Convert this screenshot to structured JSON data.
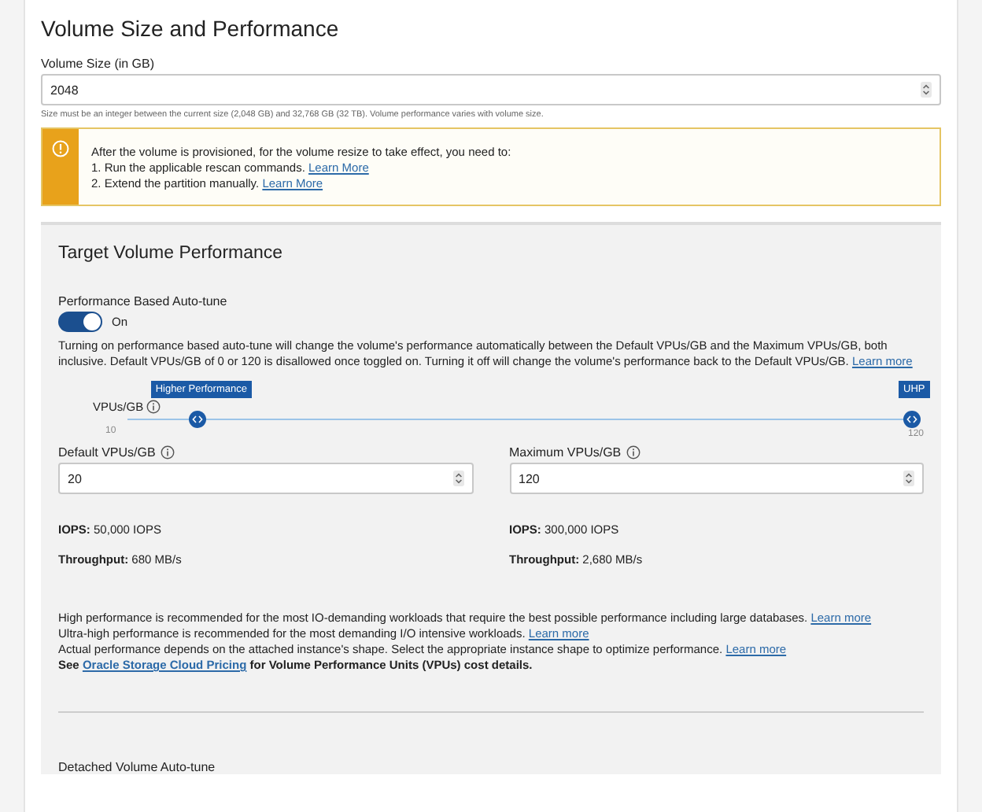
{
  "title": "Volume Size and Performance",
  "volume_size": {
    "label": "Volume Size (in GB)",
    "value": "2048",
    "help": "Size must be an integer between the current size (2,048 GB) and 32,768 GB (32 TB). Volume performance varies with volume size."
  },
  "notice": {
    "heading": "After the volume is provisioned, for the volume resize to take effect, you need to:",
    "items": [
      {
        "text": "1. Run the applicable rescan commands.",
        "link": "Learn More"
      },
      {
        "text": "2. Extend the partition manually.",
        "link": "Learn More"
      }
    ]
  },
  "target": {
    "title": "Target Volume Performance",
    "autotune": {
      "label": "Performance Based Auto-tune",
      "on": true,
      "state_text": "On"
    },
    "description": {
      "text": "Turning on performance based auto-tune will change the volume's performance automatically between the Default VPUs/GB and the Maximum VPUs/GB, both inclusive. Default VPUs/GB of 0 or 120 is disallowed once toggled on. Turning it off will change the volume's performance back to the Default VPUs/GB.",
      "link": "Learn more"
    },
    "slider": {
      "label": "VPUs/GB",
      "min": "10",
      "max": "120",
      "handles": [
        {
          "tag": "Higher Performance",
          "level": 0.09
        },
        {
          "tag": "UHP",
          "level": 1
        }
      ]
    },
    "fields": [
      {
        "label": "Default VPUs/GB",
        "value": "20",
        "iops_label": "IOPS:",
        "iops": "50,000 IOPS",
        "throughput_label": "Throughput:",
        "throughput": "680 MB/s"
      },
      {
        "label": "Maximum VPUs/GB",
        "value": "120",
        "iops_label": "IOPS:",
        "iops": "300,000 IOPS",
        "throughput_label": "Throughput:",
        "throughput": "2,680 MB/s"
      }
    ],
    "notes": [
      {
        "text": "High performance is recommended for the most IO-demanding workloads that require the best possible performance including large databases.",
        "link": "Learn more"
      },
      {
        "text": "Ultra-high performance is recommended for the most demanding I/O intensive workloads.",
        "link": "Learn more"
      },
      {
        "text": "Actual performance depends on the attached instance's shape. Select the appropriate instance shape to optimize performance.",
        "link": "Learn more"
      }
    ],
    "pricing": {
      "prefix": "See",
      "link": "Oracle Storage Cloud Pricing",
      "suffix": "for Volume Performance Units (VPUs) cost details."
    },
    "detached_label": "Detached Volume Auto-tune"
  }
}
